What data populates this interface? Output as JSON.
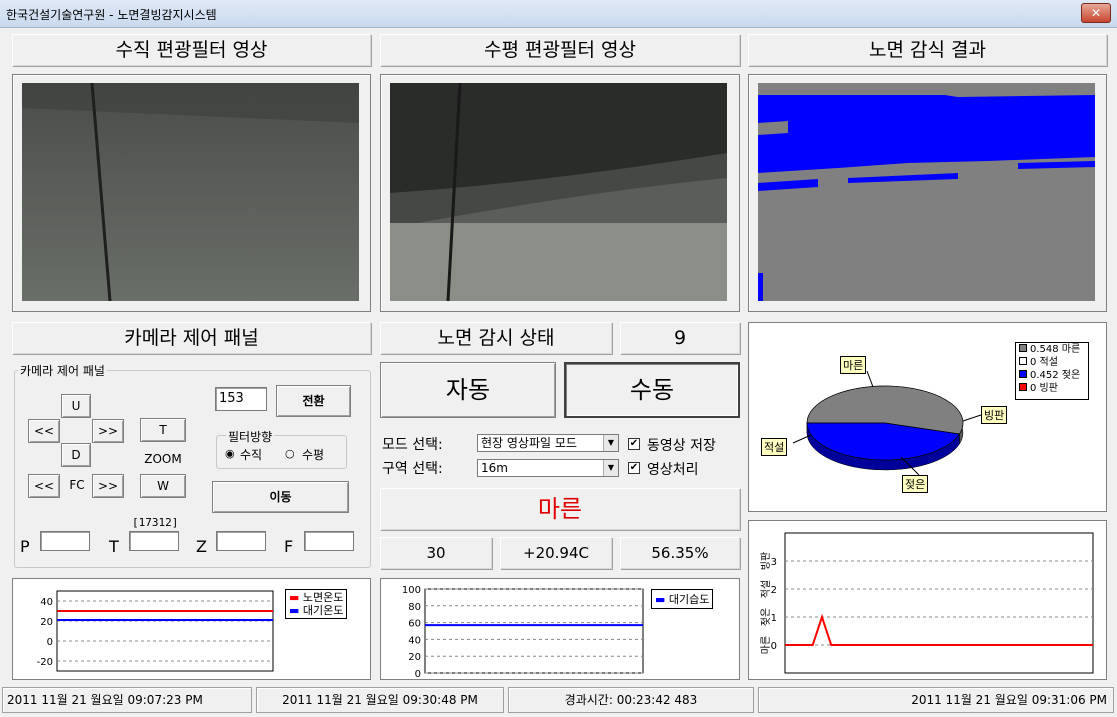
{
  "window": {
    "title": "한국건설기술연구원 - 노면결빙감지시스템",
    "close_label": "✕"
  },
  "headers": {
    "vertical": "수직 편광필터 영상",
    "horizontal": "수평 편광필터 영상",
    "result": "노면 감식 결과",
    "camera_panel": "카메라 제어 패널",
    "monitor_state": "노면 감시 상태",
    "monitor_count": "9"
  },
  "camera": {
    "group_label": "카메라 제어 패널",
    "value_input": "153",
    "switch_label": "전환",
    "up": "U",
    "down": "D",
    "left": "<<",
    "right": ">>",
    "zoom_t": "T",
    "zoom_w": "W",
    "zoom_label": "ZOOM",
    "fc_left": "<<",
    "fc_label": "FC",
    "fc_right": ">>",
    "filter_group": "필터방향",
    "radio_vertical": "수직",
    "radio_horizontal": "수평",
    "move_label": "이동",
    "t_reading": "[17312]",
    "p_label": "P",
    "t_label": "T",
    "z_label": "Z",
    "f_label": "F"
  },
  "mode": {
    "auto": "자동",
    "manual": "수동",
    "mode_select_label": "모드 선택:",
    "mode_value": "현장 영상파일 모드",
    "zone_select_label": "구역 선택:",
    "zone_value": "16m",
    "chk_video_save": "동영상 저장",
    "chk_image_proc": "영상처리",
    "result_text": "마른",
    "val_a": "30",
    "val_temp": "+20.94C",
    "val_humidity": "56.35%"
  },
  "pie_legend": [
    {
      "value": "0.548",
      "label": "마른",
      "color": "#808080"
    },
    {
      "value": "0",
      "label": "적설",
      "color": "#ffffff"
    },
    {
      "value": "0.452",
      "label": "젖은",
      "color": "#0000ff"
    },
    {
      "value": "0",
      "label": "빙판",
      "color": "#ff0000"
    }
  ],
  "pie_callouts": {
    "dry": "마른",
    "ice": "빙판",
    "snow": "적설",
    "wet": "젖은"
  },
  "temp_chart": {
    "yticks": [
      "40",
      "20",
      "0",
      "-20"
    ],
    "legend": [
      "노면온도",
      "대기온도"
    ],
    "colors": [
      "#ff0000",
      "#0000ff"
    ]
  },
  "humid_chart": {
    "yticks": [
      "100",
      "80",
      "60",
      "40",
      "20",
      "0"
    ],
    "legend": [
      "대기습도"
    ],
    "color": "#0000ff"
  },
  "state_chart": {
    "yticks": [
      "3",
      "2",
      "1",
      "0"
    ],
    "ylabels": [
      "빙판",
      "적설",
      "젖은",
      "마른"
    ],
    "color": "#ff0000"
  },
  "chart_data": [
    {
      "type": "pie",
      "categories": [
        "마른",
        "적설",
        "젖은",
        "빙판"
      ],
      "values": [
        0.548,
        0,
        0.452,
        0
      ]
    },
    {
      "type": "line",
      "ylim": [
        -30,
        50
      ],
      "series": [
        {
          "name": "노면온도",
          "values": [
            30,
            30
          ]
        },
        {
          "name": "대기온도",
          "values": [
            21,
            21
          ]
        }
      ]
    },
    {
      "type": "line",
      "ylim": [
        0,
        100
      ],
      "series": [
        {
          "name": "대기습도",
          "values": [
            57,
            57
          ]
        }
      ]
    },
    {
      "type": "line",
      "ylim": [
        -1,
        4
      ],
      "ytick_labels": [
        "빙판",
        "적설",
        "젖은",
        "마른"
      ],
      "x": [
        0,
        1,
        2,
        3,
        4,
        5,
        6,
        7,
        8,
        9,
        10
      ],
      "series": [
        {
          "values": [
            0,
            0,
            0,
            0,
            1,
            0,
            0,
            0,
            0,
            0,
            0
          ]
        }
      ]
    }
  ],
  "statusbar": {
    "start": "2011 11월 21 월요일 09:07:23 PM",
    "current": "2011 11월 21 월요일 09:30:48 PM",
    "elapsed": "경과시간: 00:23:42 483",
    "clock": "2011 11월 21 월요일 09:31:06 PM"
  }
}
